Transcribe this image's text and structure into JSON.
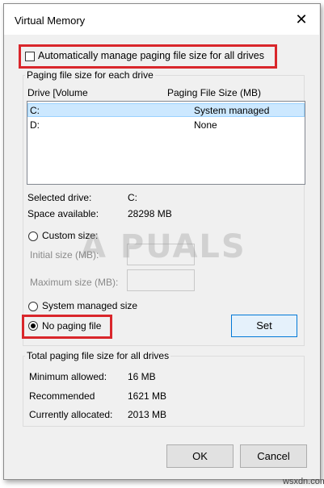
{
  "window": {
    "title": "Virtual Memory",
    "close_glyph": "✕"
  },
  "auto_manage": {
    "label": "Automatically manage paging file size for all drives",
    "checked": false
  },
  "drives_group": {
    "legend": "Paging file size for each drive",
    "col_drive": "Drive  [Volume",
    "col_size": "Paging File Size (MB)",
    "rows": [
      {
        "drive": "C:",
        "size": "System managed",
        "selected": true
      },
      {
        "drive": "D:",
        "size": "None",
        "selected": false
      }
    ],
    "selected_drive_label": "Selected drive:",
    "selected_drive_value": "C:",
    "space_label": "Space available:",
    "space_value": "28298 MB",
    "custom_size_label": "Custom size:",
    "initial_size_label": "Initial size (MB):",
    "maximum_size_label": "Maximum size (MB):",
    "initial_size_value": "",
    "maximum_size_value": "",
    "system_managed_label": "System managed size",
    "no_paging_label": "No paging file",
    "selected_option": "No paging file",
    "set_button": "Set"
  },
  "totals_group": {
    "legend": "Total paging file size for all drives",
    "min_label": "Minimum allowed:",
    "min_value": "16 MB",
    "rec_label": "Recommended",
    "rec_value": "1621 MB",
    "cur_label": "Currently allocated:",
    "cur_value": "2013 MB"
  },
  "buttons": {
    "ok": "OK",
    "cancel": "Cancel"
  },
  "watermark": "A PUALS",
  "footer": "wsxdn.com",
  "colors": {
    "highlight": "#d9262b",
    "selection": "#cce8ff",
    "default_button": "#0078d7"
  }
}
